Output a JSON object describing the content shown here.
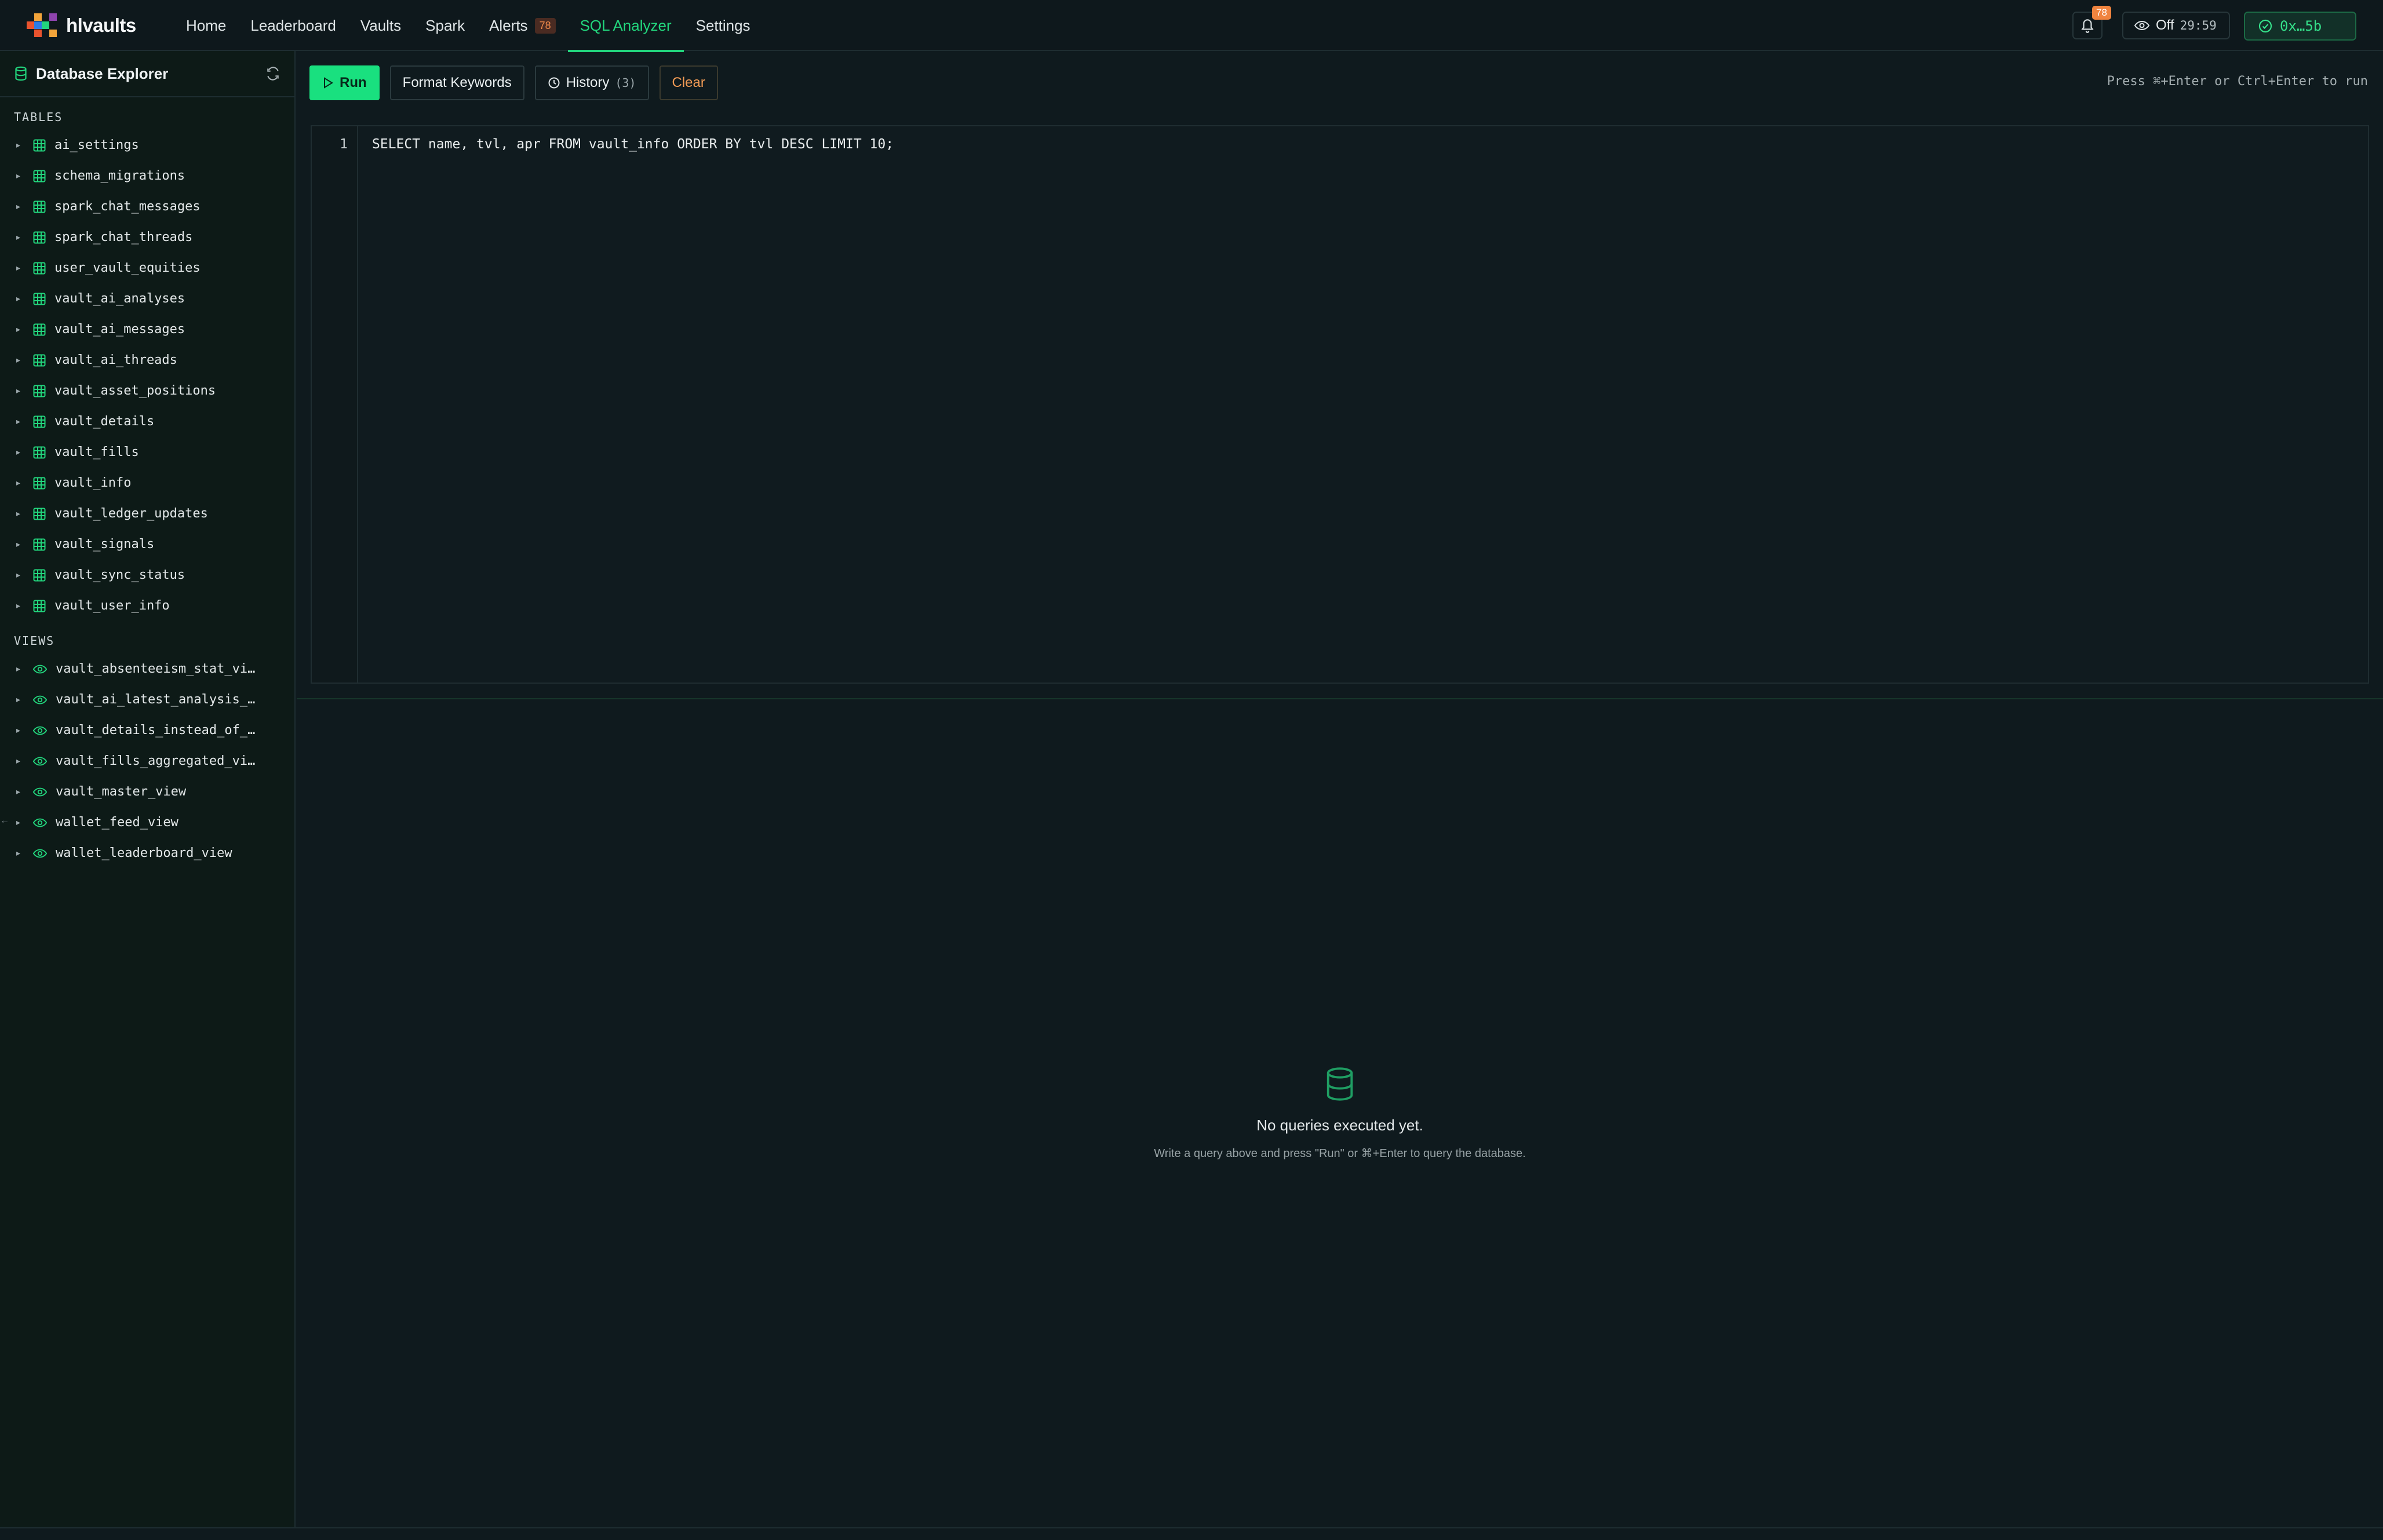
{
  "brand": {
    "name": "hlvaults"
  },
  "nav": {
    "items": [
      {
        "label": "Home"
      },
      {
        "label": "Leaderboard"
      },
      {
        "label": "Vaults"
      },
      {
        "label": "Spark"
      },
      {
        "label": "Alerts",
        "badge": "78"
      },
      {
        "label": "SQL Analyzer",
        "active": true
      },
      {
        "label": "Settings"
      }
    ]
  },
  "header": {
    "notifications_count": "78",
    "visibility_label": "Off",
    "timer": "29:59",
    "wallet": "0x…5b"
  },
  "sidebar": {
    "title": "Database Explorer",
    "tables_heading": "TABLES",
    "tables": [
      "ai_settings",
      "schema_migrations",
      "spark_chat_messages",
      "spark_chat_threads",
      "user_vault_equities",
      "vault_ai_analyses",
      "vault_ai_messages",
      "vault_ai_threads",
      "vault_asset_positions",
      "vault_details",
      "vault_fills",
      "vault_info",
      "vault_ledger_updates",
      "vault_signals",
      "vault_sync_status",
      "vault_user_info"
    ],
    "views_heading": "VIEWS",
    "views": [
      "vault_absenteeism_stat_vi…",
      "vault_ai_latest_analysis_…",
      "vault_details_instead_of_…",
      "vault_fills_aggregated_vi…",
      "vault_master_view",
      "wallet_feed_view",
      "wallet_leaderboard_view"
    ]
  },
  "toolbar": {
    "run_label": "Run",
    "format_label": "Format Keywords",
    "history_label": "History",
    "history_count": "(3)",
    "clear_label": "Clear",
    "hint": "Press ⌘+Enter or Ctrl+Enter to run"
  },
  "editor": {
    "line_number": "1",
    "code": "SELECT name, tvl, apr FROM vault_info ORDER BY tvl DESC LIMIT 10;"
  },
  "results": {
    "empty_title": "No queries executed yet.",
    "empty_subtitle": "Write a query above and press \"Run\" or ⌘+Enter to query the database."
  },
  "colors": {
    "accent": "#22d67d",
    "warning": "#f09a55",
    "badge": "#f0843f"
  }
}
